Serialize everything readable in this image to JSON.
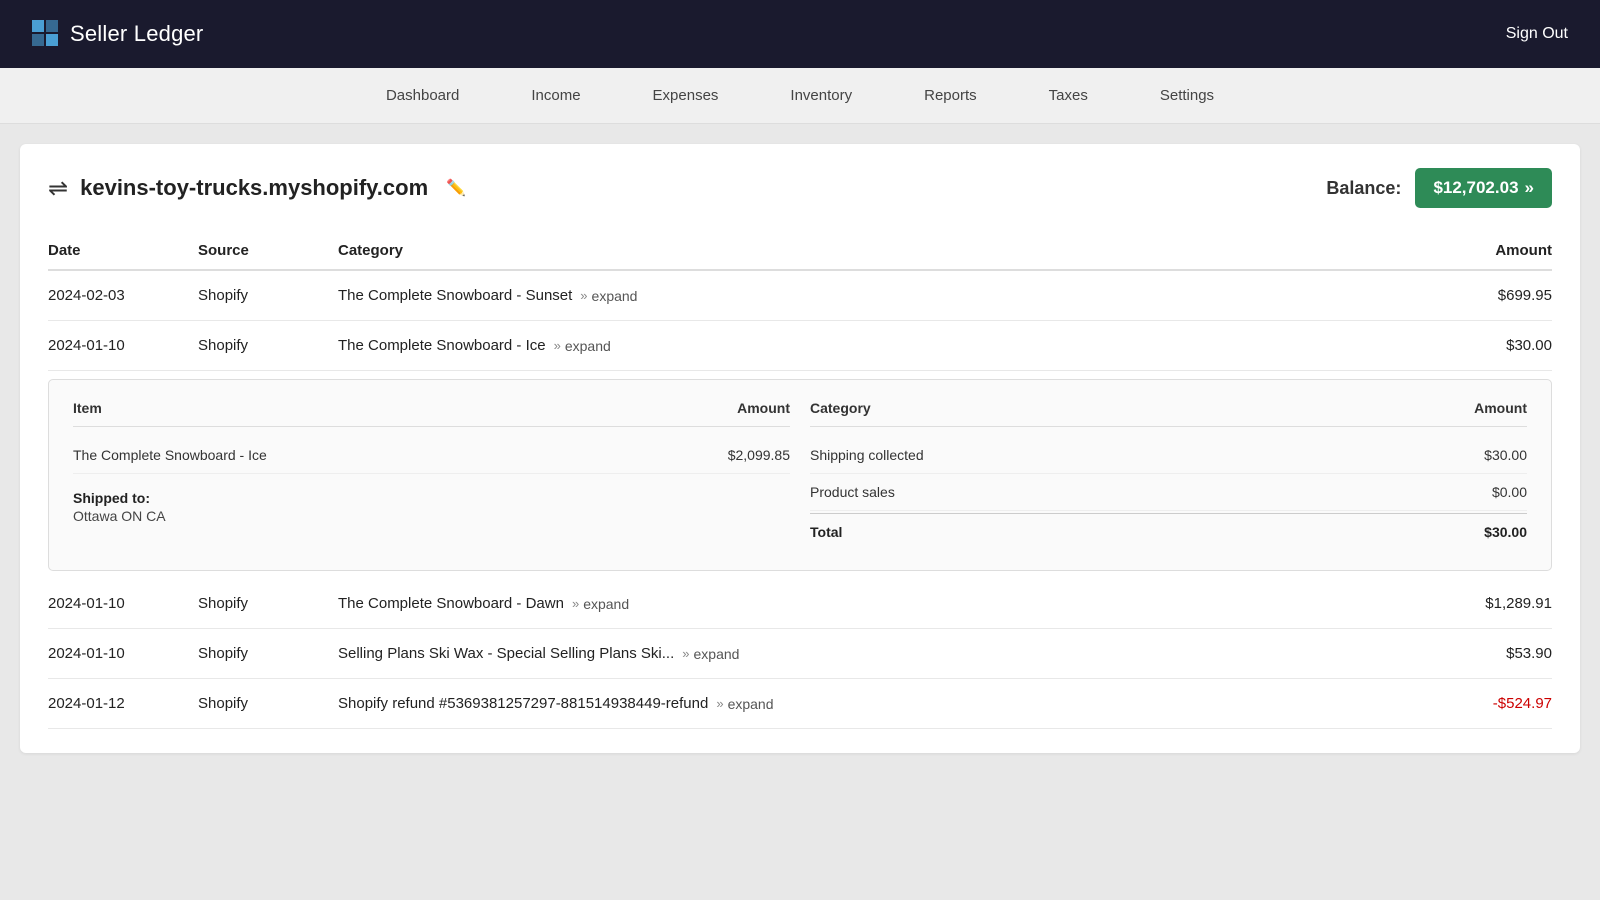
{
  "header": {
    "logo_text": "Seller Ledger",
    "sign_out_label": "Sign Out"
  },
  "nav": {
    "items": [
      {
        "label": "Dashboard"
      },
      {
        "label": "Income"
      },
      {
        "label": "Expenses"
      },
      {
        "label": "Inventory"
      },
      {
        "label": "Reports"
      },
      {
        "label": "Taxes"
      },
      {
        "label": "Settings"
      }
    ]
  },
  "account": {
    "name": "kevins-toy-trucks.myshopify.com",
    "balance_label": "Balance:",
    "balance_value": "$12,702.03"
  },
  "table": {
    "headers": {
      "date": "Date",
      "source": "Source",
      "category": "Category",
      "amount": "Amount"
    },
    "rows": [
      {
        "date": "2024-02-03",
        "source": "Shopify",
        "category": "The Complete Snowboard - Sunset",
        "expand_label": "expand",
        "amount": "$699.95",
        "negative": false,
        "expanded": false
      },
      {
        "date": "2024-01-10",
        "source": "Shopify",
        "category": "The Complete Snowboard - Ice",
        "expand_label": "expand",
        "amount": "$30.00",
        "negative": false,
        "expanded": true
      },
      {
        "date": "2024-01-10",
        "source": "Shopify",
        "category": "The Complete Snowboard - Dawn",
        "expand_label": "expand",
        "amount": "$1,289.91",
        "negative": false,
        "expanded": false
      },
      {
        "date": "2024-01-10",
        "source": "Shopify",
        "category": "Selling Plans Ski Wax - Special Selling Plans Ski...",
        "expand_label": "expand",
        "amount": "$53.90",
        "negative": false,
        "expanded": false
      },
      {
        "date": "2024-01-12",
        "source": "Shopify",
        "category": "Shopify refund #5369381257297-881514938449-refund",
        "expand_label": "expand",
        "amount": "-$524.97",
        "negative": true,
        "expanded": false
      }
    ]
  },
  "detail": {
    "items_header": "Item",
    "items_amount_header": "Amount",
    "items": [
      {
        "label": "The Complete Snowboard - Ice",
        "amount": "$2,099.85"
      }
    ],
    "shipped_label": "Shipped to:",
    "shipped_value": "Ottawa ON CA",
    "categories_header": "Category",
    "categories_amount_header": "Amount",
    "categories": [
      {
        "label": "Shipping collected",
        "amount": "$30.00"
      },
      {
        "label": "Product sales",
        "amount": "$0.00"
      }
    ],
    "total_label": "Total",
    "total_amount": "$30.00"
  }
}
